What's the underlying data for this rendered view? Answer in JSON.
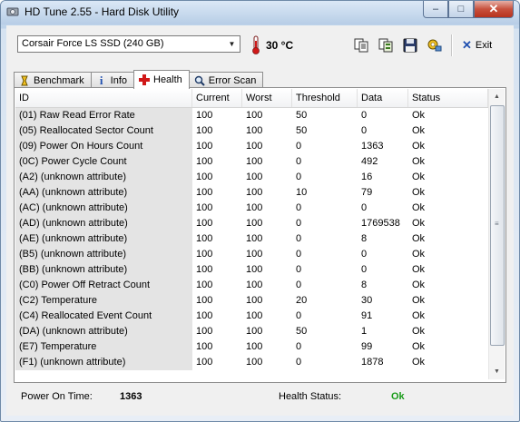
{
  "window": {
    "title": "HD Tune 2.55 - Hard Disk Utility"
  },
  "caption": {
    "minimize": "–",
    "maximize": "□",
    "close": "✕"
  },
  "toolbar": {
    "drive": "Corsair Force LS SSD (240 GB)",
    "temperature": "30 °C",
    "exit_label": "Exit",
    "icons": [
      "copy-icon",
      "copy-all-icon",
      "save-icon",
      "options-icon"
    ]
  },
  "tabs": [
    {
      "label": "Benchmark",
      "icon": "benchmark-icon"
    },
    {
      "label": "Info",
      "icon": "info-icon"
    },
    {
      "label": "Health",
      "icon": "health-icon",
      "active": true
    },
    {
      "label": "Error Scan",
      "icon": "magnifier-icon"
    }
  ],
  "table": {
    "columns": [
      "ID",
      "Current",
      "Worst",
      "Threshold",
      "Data",
      "Status"
    ],
    "rows": [
      [
        "(01) Raw Read Error Rate",
        "100",
        "100",
        "50",
        "0",
        "Ok"
      ],
      [
        "(05) Reallocated Sector Count",
        "100",
        "100",
        "50",
        "0",
        "Ok"
      ],
      [
        "(09) Power On Hours Count",
        "100",
        "100",
        "0",
        "1363",
        "Ok"
      ],
      [
        "(0C) Power Cycle Count",
        "100",
        "100",
        "0",
        "492",
        "Ok"
      ],
      [
        "(A2) (unknown attribute)",
        "100",
        "100",
        "0",
        "16",
        "Ok"
      ],
      [
        "(AA) (unknown attribute)",
        "100",
        "100",
        "10",
        "79",
        "Ok"
      ],
      [
        "(AC) (unknown attribute)",
        "100",
        "100",
        "0",
        "0",
        "Ok"
      ],
      [
        "(AD) (unknown attribute)",
        "100",
        "100",
        "0",
        "1769538",
        "Ok"
      ],
      [
        "(AE) (unknown attribute)",
        "100",
        "100",
        "0",
        "8",
        "Ok"
      ],
      [
        "(B5) (unknown attribute)",
        "100",
        "100",
        "0",
        "0",
        "Ok"
      ],
      [
        "(BB) (unknown attribute)",
        "100",
        "100",
        "0",
        "0",
        "Ok"
      ],
      [
        "(C0) Power Off Retract Count",
        "100",
        "100",
        "0",
        "8",
        "Ok"
      ],
      [
        "(C2) Temperature",
        "100",
        "100",
        "20",
        "30",
        "Ok"
      ],
      [
        "(C4) Reallocated Event Count",
        "100",
        "100",
        "0",
        "91",
        "Ok"
      ],
      [
        "(DA) (unknown attribute)",
        "100",
        "100",
        "50",
        "1",
        "Ok"
      ],
      [
        "(E7) Temperature",
        "100",
        "100",
        "0",
        "99",
        "Ok"
      ],
      [
        "(F1) (unknown attribute)",
        "100",
        "100",
        "0",
        "1878",
        "Ok"
      ]
    ]
  },
  "footer": {
    "power_on_label": "Power On Time:",
    "power_on_value": "1363",
    "health_label": "Health Status:",
    "health_value": "Ok"
  },
  "colors": {
    "health_ok": "#1a9c1a",
    "id_column_bg": "#e4e4e4"
  }
}
